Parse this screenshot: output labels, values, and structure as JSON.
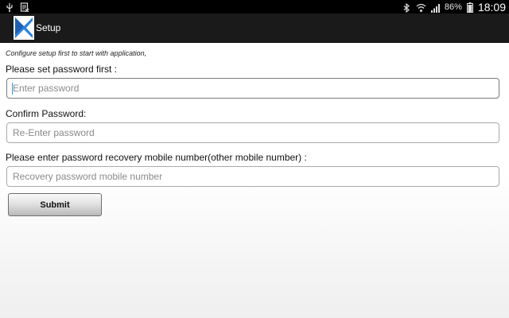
{
  "status_bar": {
    "left_icons": [
      "usb-icon",
      "notification-doc-icon"
    ],
    "right_icons": [
      "bluetooth-icon",
      "wifi-icon",
      "signal-icon",
      "battery-icon"
    ],
    "battery_text": "86%",
    "time": "18:09"
  },
  "action_bar": {
    "title": "Setup",
    "logo_icon": "app-logo-icon",
    "colors": {
      "background": "#1a1a1a",
      "logo": "#2b82d9"
    }
  },
  "form": {
    "hint": "Configure setup first to start with application,",
    "password_label": "Please set password first :",
    "password_placeholder": "Enter password",
    "password_value": "",
    "confirm_label": "Confirm Password:",
    "confirm_placeholder": "Re-Enter password",
    "confirm_value": "",
    "recovery_label": "Please enter password recovery mobile number(other mobile number) :",
    "recovery_placeholder": "Recovery password mobile number",
    "recovery_value": "",
    "submit_label": "Submit"
  }
}
